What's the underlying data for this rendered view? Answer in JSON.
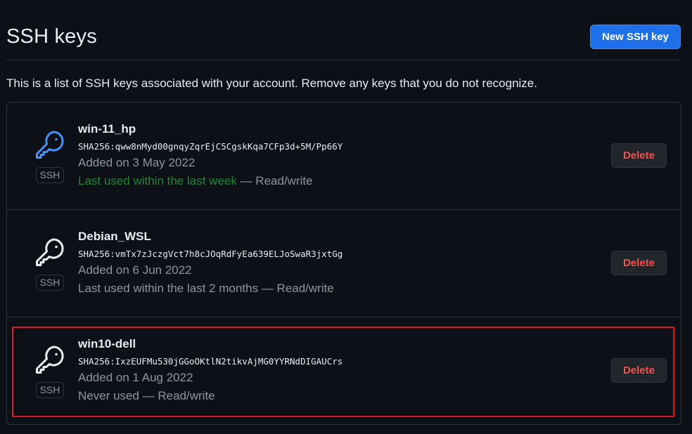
{
  "header": {
    "title": "SSH keys",
    "new_key_button": "New SSH key"
  },
  "description": "This is a list of SSH keys associated with your account. Remove any keys that you do not recognize.",
  "colors": {
    "accent": "#1f6feb",
    "danger": "#f85149",
    "recent_usage": "#238636",
    "muted": "#8d96a0",
    "highlight": "#e0181e"
  },
  "keys": [
    {
      "title": "win-11_hp",
      "fingerprint": "SHA256:qww8nMyd00gnqyZqrEjC5CgskKqa7CFp3d+5M/Pp66Y",
      "added_on": "Added on 3 May 2022",
      "last_used": "Last used within the last week",
      "access": " — Read/write",
      "badge": "SSH",
      "icon": "key-icon",
      "icon_color": "#4493f8",
      "recent": true,
      "delete_label": "Delete"
    },
    {
      "title": "Debian_WSL",
      "fingerprint": "SHA256:vmTx7zJczgVct7h8cJOqRdFyEa639ELJoSwaR3jxtGg",
      "added_on": "Added on 6 Jun 2022",
      "last_used": "Last used within the last 2 months",
      "access": " — Read/write",
      "badge": "SSH",
      "icon": "key-icon",
      "icon_color": "#e6edf3",
      "recent": false,
      "delete_label": "Delete"
    },
    {
      "title": "win10-dell",
      "fingerprint": "SHA256:IxzEUFMu530jGGoOKtlN2tikvAjMG0YYRNdDIGAUCrs",
      "added_on": "Added on 1 Aug 2022",
      "last_used": "Never used",
      "access": " — Read/write",
      "badge": "SSH",
      "icon": "key-icon",
      "icon_color": "#e6edf3",
      "recent": false,
      "delete_label": "Delete",
      "highlighted": true
    }
  ]
}
